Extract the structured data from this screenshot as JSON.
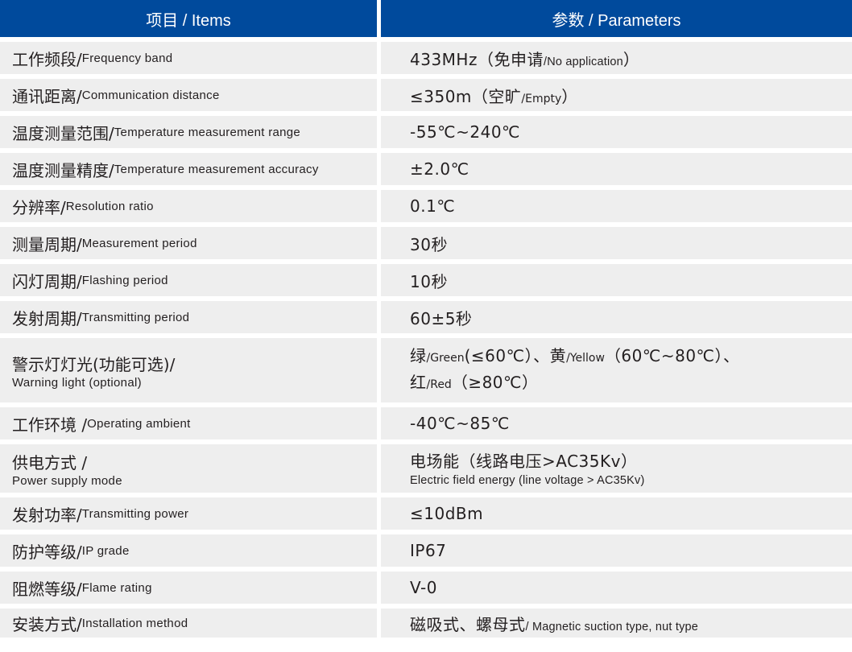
{
  "header": {
    "items_label": "项目 / Items",
    "parameters_label": "参数 / Parameters"
  },
  "colors": {
    "header_bg": "#004a9c",
    "header_text": "#ffffff",
    "row_bg": "#eeeeee",
    "text": "#231f20"
  },
  "rows": [
    {
      "item_zh": "工作频段/",
      "item_en": "Frequency band",
      "value_main": "433MHz（免申请",
      "value_en": "/No application",
      "value_tail": "）"
    },
    {
      "item_zh": "通讯距离/",
      "item_en": "Communication distance",
      "value_main": "≤350m（空旷",
      "value_en": "/Empty",
      "value_tail": "）"
    },
    {
      "item_zh": "温度测量范围/",
      "item_en": "Temperature measurement range",
      "value_main": "-55℃~240℃"
    },
    {
      "item_zh": "温度测量精度/",
      "item_en": "Temperature measurement accuracy",
      "value_main": "±2.0℃"
    },
    {
      "item_zh": "分辨率/",
      "item_en": "Resolution ratio",
      "value_main": "0.1℃"
    },
    {
      "item_zh": "测量周期/",
      "item_en": "Measurement period",
      "value_main": "30秒"
    },
    {
      "item_zh": "闪灯周期/",
      "item_en": "Flashing period",
      "value_main": "10秒"
    },
    {
      "item_zh": "发射周期/",
      "item_en": "Transmitting period",
      "value_main": "60±5秒"
    },
    {
      "item_zh": "警示灯灯光(功能可选)/",
      "item_en": "Warning light (optional)",
      "value_line1": {
        "green_zh": "绿",
        "green_en": "/Green",
        "green_range": "(≤60℃）、",
        "yellow_zh": "黄",
        "yellow_en": "/Yellow",
        "yellow_range": "（60℃~80℃）、"
      },
      "value_line2": {
        "red_zh": "红",
        "red_en": "/Red",
        "red_range": "（≥80℃）"
      }
    },
    {
      "item_zh": "工作环境 /",
      "item_en": "Operating ambient",
      "value_main": "-40℃~85℃"
    },
    {
      "item_zh": "供电方式 /",
      "item_en": "Power supply mode",
      "value_main": "电场能（线路电压>AC35Kv）",
      "value_sub": "Electric field energy (line voltage > AC35Kv)"
    },
    {
      "item_zh": "发射功率/",
      "item_en": "Transmitting power",
      "value_main": "≤10dBm"
    },
    {
      "item_zh": "防护等级/",
      "item_en": "IP grade",
      "value_main": "IP67"
    },
    {
      "item_zh": "阻燃等级/",
      "item_en": "Flame rating",
      "value_main": "V-0"
    },
    {
      "item_zh": "安装方式/",
      "item_en": "Installation method",
      "value_main": "磁吸式、螺母式",
      "value_en": "/ Magnetic suction type, nut type"
    }
  ]
}
